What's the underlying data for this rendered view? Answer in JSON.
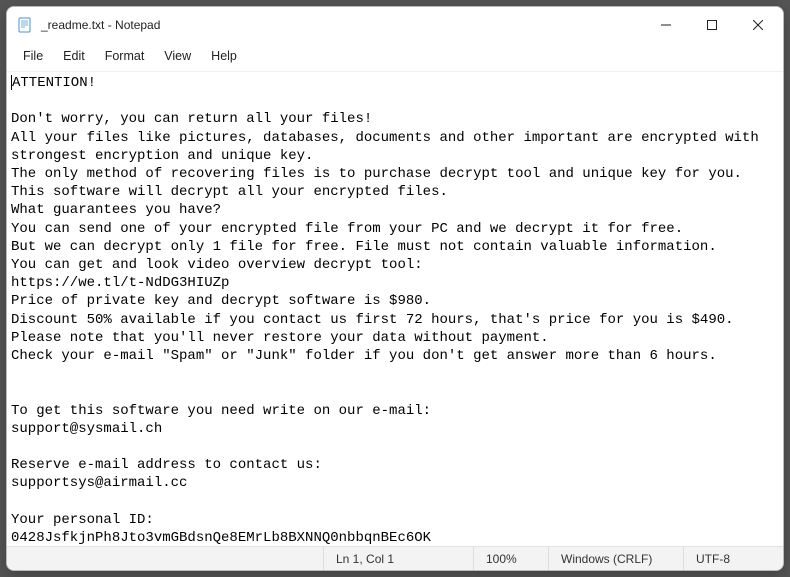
{
  "window": {
    "title": "_readme.txt - Notepad",
    "icon_name": "notepad-icon"
  },
  "window_controls": {
    "minimize": "minimize",
    "maximize": "maximize",
    "close": "close"
  },
  "menu": {
    "items": [
      {
        "label": "File"
      },
      {
        "label": "Edit"
      },
      {
        "label": "Format"
      },
      {
        "label": "View"
      },
      {
        "label": "Help"
      }
    ]
  },
  "document": {
    "text": "ATTENTION!\n\nDon't worry, you can return all your files!\nAll your files like pictures, databases, documents and other important are encrypted with strongest encryption and unique key.\nThe only method of recovering files is to purchase decrypt tool and unique key for you.\nThis software will decrypt all your encrypted files.\nWhat guarantees you have?\nYou can send one of your encrypted file from your PC and we decrypt it for free.\nBut we can decrypt only 1 file for free. File must not contain valuable information.\nYou can get and look video overview decrypt tool:\nhttps://we.tl/t-NdDG3HIUZp\nPrice of private key and decrypt software is $980.\nDiscount 50% available if you contact us first 72 hours, that's price for you is $490.\nPlease note that you'll never restore your data without payment.\nCheck your e-mail \"Spam\" or \"Junk\" folder if you don't get answer more than 6 hours.\n\n\nTo get this software you need write on our e-mail:\nsupport@sysmail.ch\n\nReserve e-mail address to contact us:\nsupportsys@airmail.cc\n\nYour personal ID:\n0428JsfkjnPh8Jto3vmGBdsnQe8EMrLb8BXNNQ0nbbqnBEc6OK"
  },
  "status": {
    "line_col": "Ln 1, Col 1",
    "zoom": "100%",
    "eol": "Windows (CRLF)",
    "encoding": "UTF-8"
  }
}
